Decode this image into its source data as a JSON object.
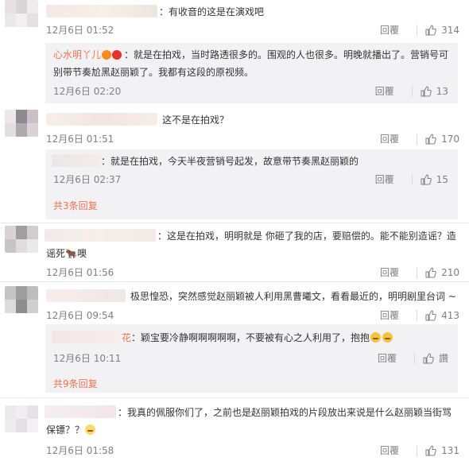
{
  "ui": {
    "reply_label": "回覆",
    "reply_icon_char": "讚",
    "like_icon": "thumbs-up-icon"
  },
  "comments": [
    {
      "text": "：有收音的这是在演戏吧",
      "date": "12月6日 01:52",
      "likes": "314"
    },
    {
      "name": "心水明丫儿",
      "text": "：就是在拍戏，当时路透很多的。围观的人也很多。明晚就播出了。营销号可别带节奏尬黑赵丽颖了。我都有这段的原视频。",
      "date": "12月6日 02:20",
      "likes": "13"
    },
    {
      "text": "这不是在拍戏？",
      "date": "12月6日 01:51",
      "likes": "170"
    },
    {
      "text": "：就是在拍戏，今天半夜营销号起发，故意带节奏黑赵丽颖的",
      "date": "12月6日 02:37",
      "likes": "15"
    },
    {
      "more": "共3条回复"
    },
    {
      "text": "：这是在拍戏，明明就是 你砸了我的店，要赔偿的。能不能别造谣？造谣死🐂噢",
      "date": "12月6日 01:56",
      "likes": "210"
    },
    {
      "text": "极思惶恐，突然感觉赵丽颖被人利用黑曹曦文，看看最近的，明明剧里台词 ~",
      "date": "12月6日 09:54",
      "likes": "413"
    },
    {
      "name_tail": "花",
      "text": "：颖宝要冷静啊啊啊啊啊，不要被有心之人利用了，抱抱",
      "date": "12月6日 10:11"
    },
    {
      "more": "共9条回复"
    },
    {
      "text": "：我真的佩服你们了，之前也是赵丽颖拍戏的片段放出来说是什么赵丽颖当街骂保镖？？",
      "date": "12月6日 01:58",
      "likes": "131"
    }
  ]
}
